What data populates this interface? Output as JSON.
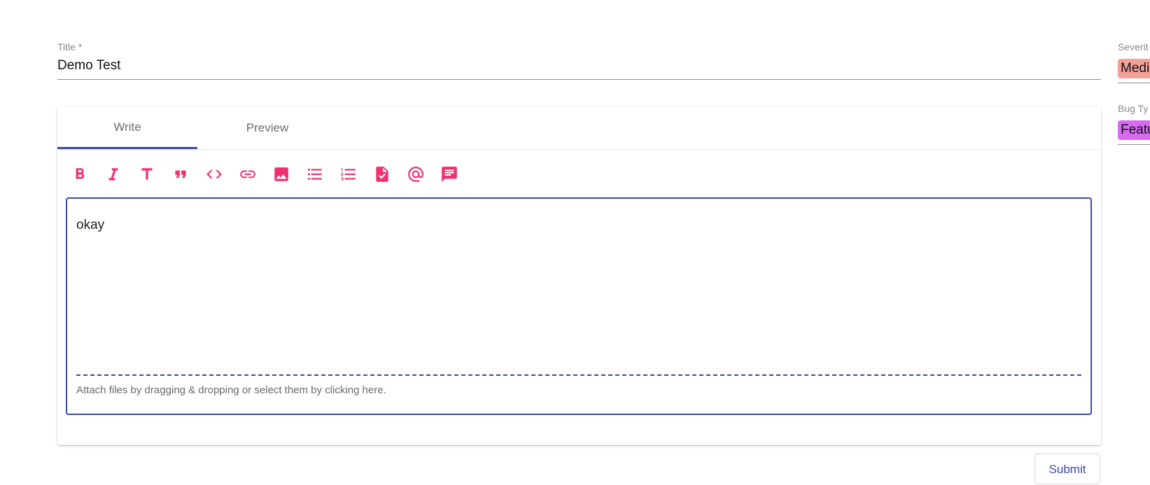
{
  "form": {
    "title_label": "Title *",
    "title_value": "Demo Test"
  },
  "tabs": [
    {
      "label": "Write",
      "active": true
    },
    {
      "label": "Preview",
      "active": false
    }
  ],
  "toolbar": {
    "color": "#f0306f",
    "icons": [
      "bold-icon",
      "italic-icon",
      "heading-icon",
      "quote-icon",
      "code-icon",
      "link-icon",
      "image-icon",
      "bulleted-list-icon",
      "numbered-list-icon",
      "task-file-icon",
      "mention-icon",
      "comment-icon"
    ]
  },
  "editor": {
    "content": "okay",
    "attach_hint": "Attach files by dragging & dropping or select them by clicking here.",
    "accent_color": "#3949ab"
  },
  "actions": {
    "submit_label": "Submit"
  },
  "sidebar": {
    "severity_label": "Severit",
    "severity_value": "Medi",
    "severity_color": "#f4a19a",
    "bug_type_label": "Bug Ty",
    "bug_type_value": "Featu",
    "bug_type_color": "#d66cf0"
  }
}
